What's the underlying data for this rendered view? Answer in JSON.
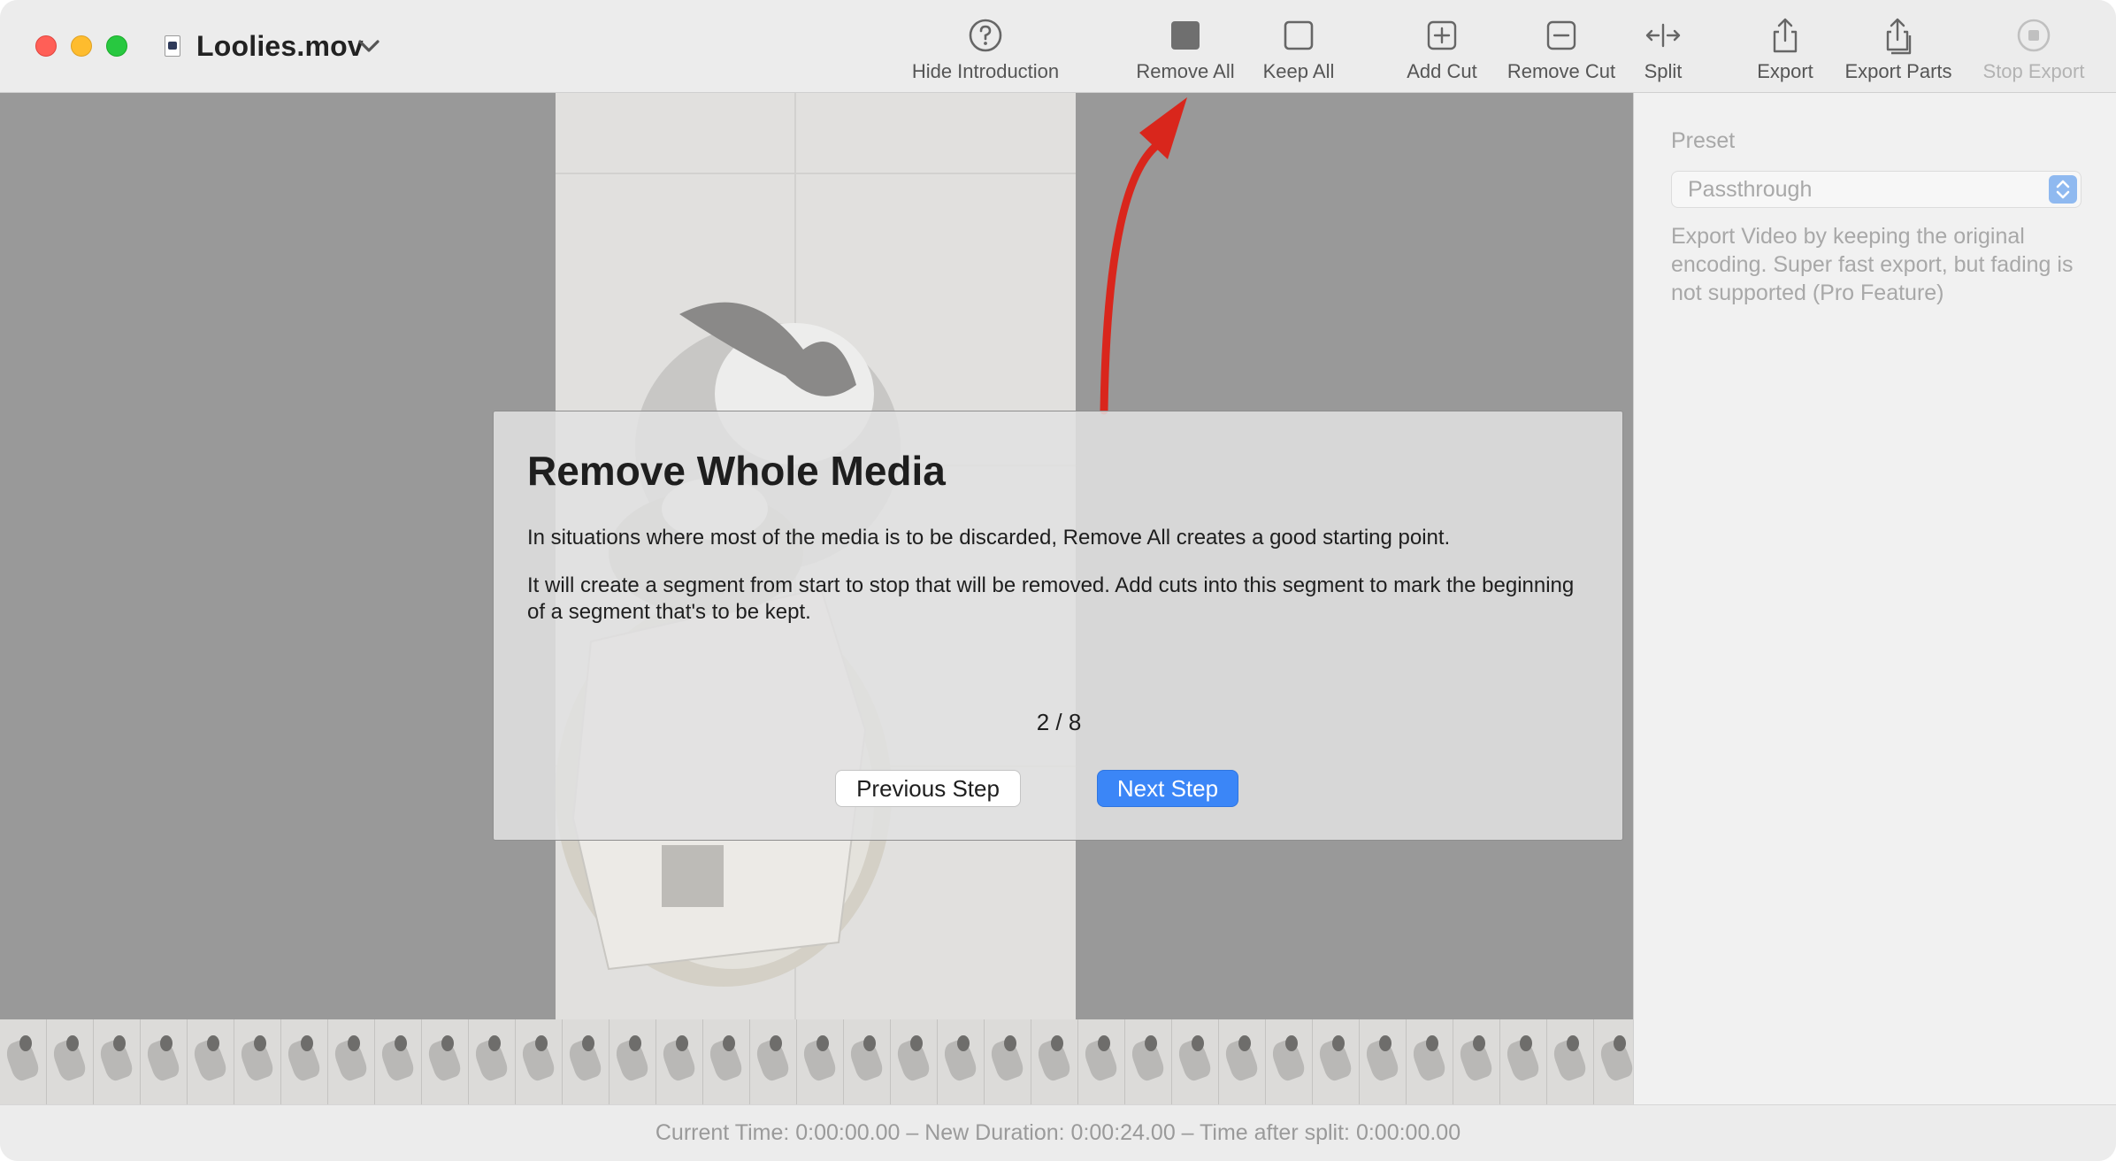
{
  "window": {
    "document_title": "Loolies.mov"
  },
  "toolbar": {
    "items": [
      {
        "label": "Hide Introduction",
        "icon": "question-circle-icon"
      },
      {
        "label": "Remove All",
        "icon": "filled-square-icon"
      },
      {
        "label": "Keep All",
        "icon": "empty-square-icon"
      },
      {
        "label": "Add Cut",
        "icon": "plus-square-icon"
      },
      {
        "label": "Remove Cut",
        "icon": "minus-square-icon"
      },
      {
        "label": "Split",
        "icon": "split-arrows-icon"
      },
      {
        "label": "Export",
        "icon": "share-icon"
      },
      {
        "label": "Export Parts",
        "icon": "share-stack-icon"
      },
      {
        "label": "Stop Export",
        "icon": "stop-circle-icon",
        "disabled": true
      }
    ]
  },
  "sidebar": {
    "preset_label": "Preset",
    "preset_value": "Passthrough",
    "description": "Export Video by keeping the original encoding. Super fast export, but fading is not supported (Pro Feature)"
  },
  "intro": {
    "title": "Remove Whole Media",
    "paragraph1": "In situations where most of the media is to be discarded, Remove All creates a good starting point.",
    "paragraph2": "It will create a segment from start to stop that will be removed. Add cuts into this segment to mark the beginning of a segment that's to be kept.",
    "step_indicator": "2 / 8",
    "previous_label": "Previous Step",
    "next_label": "Next Step"
  },
  "status": {
    "text": "Current Time: 0:00:00.00 – New Duration: 0:00:24.00 – Time after split: 0:00:00.00"
  },
  "colors": {
    "accent": "#3b86f7",
    "arrow": "#d9261c",
    "close": "#ff5f57",
    "minimize": "#febc2e",
    "maximize": "#28c840"
  }
}
